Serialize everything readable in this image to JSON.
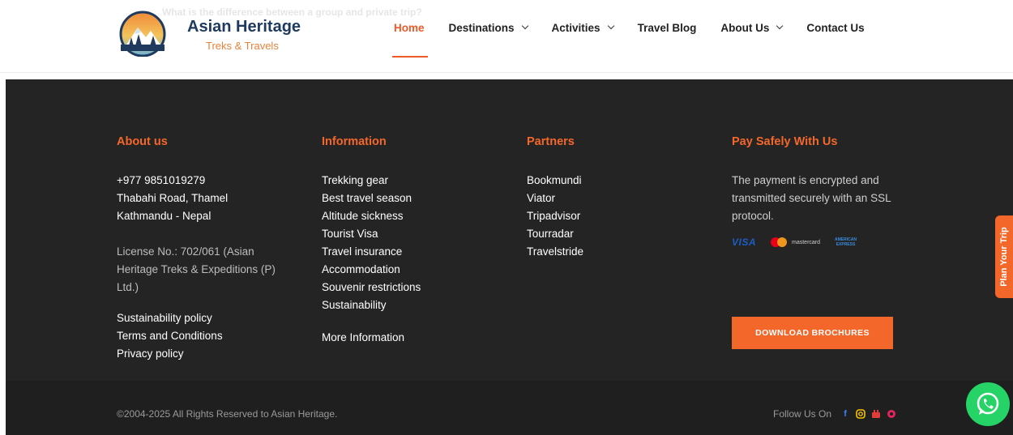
{
  "header": {
    "ghost_text": "What is the difference between a group and private trip?",
    "logo_title": "Asian Heritage",
    "logo_subtitle": "Treks & Travels",
    "nav": [
      {
        "label": "Home",
        "active": true,
        "dropdown": false
      },
      {
        "label": "Destinations",
        "active": false,
        "dropdown": true
      },
      {
        "label": "Activities",
        "active": false,
        "dropdown": true
      },
      {
        "label": "Travel Blog",
        "active": false,
        "dropdown": false
      },
      {
        "label": "About Us",
        "active": false,
        "dropdown": true
      },
      {
        "label": "Contact Us",
        "active": false,
        "dropdown": false
      }
    ]
  },
  "footer": {
    "about": {
      "title": "About us",
      "phone": "+977 9851019279",
      "address1": "Thabahi Road, Thamel",
      "address2": "Kathmandu - Nepal",
      "license": "License No.: 702/061 (Asian Heritage Treks & Expeditions (P) Ltd.)",
      "links": [
        "Sustainability policy",
        "Terms and Conditions",
        "Privacy policy"
      ]
    },
    "information": {
      "title": "Information",
      "links": [
        "Trekking gear",
        "Best travel season",
        "Altitude sickness",
        "Tourist Visa",
        "Travel insurance",
        "Accommodation",
        "Souvenir restrictions",
        "Sustainability"
      ],
      "more": "More Information"
    },
    "partners": {
      "title": "Partners",
      "links": [
        "Bookmundi",
        "Viator",
        "Tripadvisor",
        "Tourradar",
        "Travelstride"
      ]
    },
    "pay": {
      "title": "Pay Safely With Us",
      "text": "The payment is encrypted and transmitted securely with an SSL protocol.",
      "cards": {
        "visa": "VISA",
        "mastercard": "mastercard",
        "amex_line1": "AMERICAN",
        "amex_line2": "EXPRESS"
      },
      "download_label": "DOWNLOAD BROCHURES"
    }
  },
  "bottom": {
    "copyright": "©2004-2025 All Rights Reserved to Asian Heritage.",
    "follow_label": "Follow Us On",
    "social_icons": [
      "facebook-icon",
      "instagram-icon",
      "youtube-icon",
      "pinterest-icon"
    ]
  },
  "side_tab": {
    "label": "Plan Your Trip"
  },
  "colors": {
    "accent": "#f4672b",
    "footer_bg": "#242424",
    "bottom_bg": "#1f1f1f",
    "whatsapp": "#25d366"
  }
}
